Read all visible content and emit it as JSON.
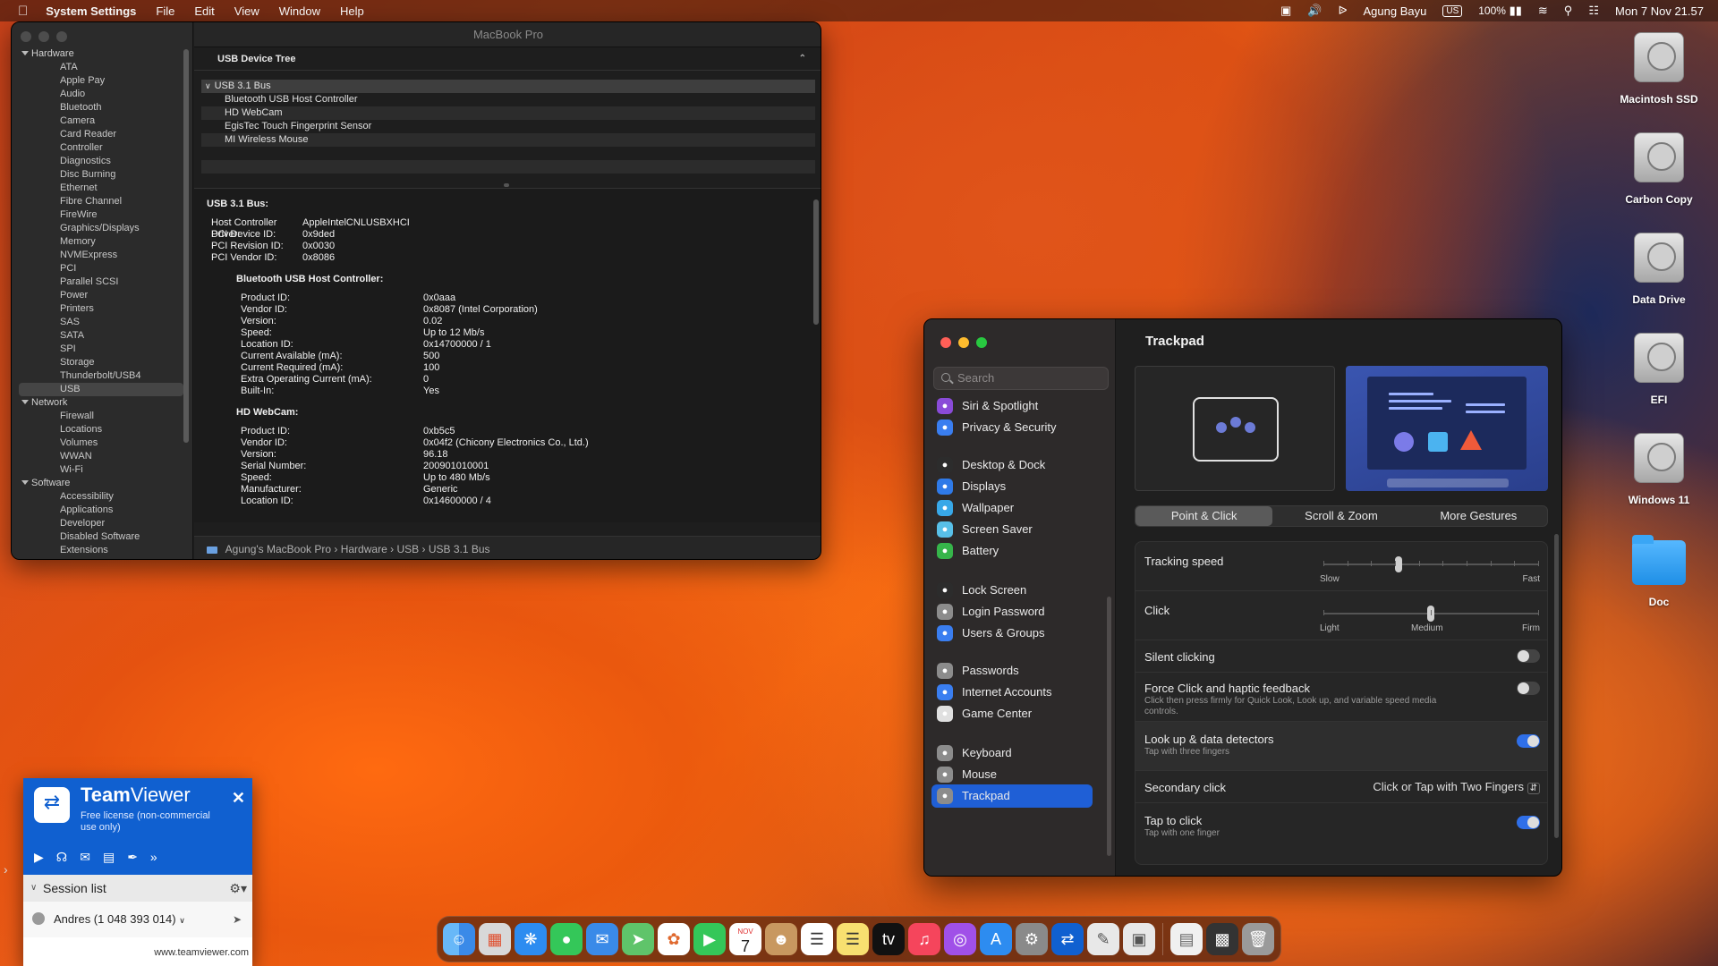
{
  "menubar": {
    "app": "System Settings",
    "menus": [
      "File",
      "Edit",
      "View",
      "Window",
      "Help"
    ],
    "user": "Agung Bayu",
    "input": "US",
    "battery": "100%",
    "datetime": "Mon 7 Nov  21.57"
  },
  "sysinfo": {
    "title": "MacBook Pro",
    "sidebar": {
      "hardware": "Hardware",
      "hardware_items": [
        "ATA",
        "Apple Pay",
        "Audio",
        "Bluetooth",
        "Camera",
        "Card Reader",
        "Controller",
        "Diagnostics",
        "Disc Burning",
        "Ethernet",
        "Fibre Channel",
        "FireWire",
        "Graphics/Displays",
        "Memory",
        "NVMExpress",
        "PCI",
        "Parallel SCSI",
        "Power",
        "Printers",
        "SAS",
        "SATA",
        "SPI",
        "Storage",
        "Thunderbolt/USB4",
        "USB"
      ],
      "network": "Network",
      "network_items": [
        "Firewall",
        "Locations",
        "Volumes",
        "WWAN",
        "Wi-Fi"
      ],
      "software": "Software",
      "software_items": [
        "Accessibility",
        "Applications",
        "Developer",
        "Disabled Software",
        "Extensions"
      ]
    },
    "tree_header": "USB Device Tree",
    "tree": {
      "bus": "USB 3.1 Bus",
      "devices": [
        "Bluetooth USB Host Controller",
        "HD WebCam",
        "EgisTec Touch Fingerprint Sensor",
        "MI Wireless Mouse"
      ]
    },
    "detail": {
      "bus_title": "USB 3.1 Bus:",
      "bus_props": [
        [
          "Host Controller Driver:",
          "AppleIntelCNLUSBXHCI"
        ],
        [
          "PCI Device ID:",
          "0x9ded"
        ],
        [
          "PCI Revision ID:",
          "0x0030"
        ],
        [
          "PCI Vendor ID:",
          "0x8086"
        ]
      ],
      "dev1_title": "Bluetooth USB Host Controller:",
      "dev1_props": [
        [
          "Product ID:",
          "0x0aaa"
        ],
        [
          "Vendor ID:",
          "0x8087  (Intel Corporation)"
        ],
        [
          "Version:",
          "0.02"
        ],
        [
          "Speed:",
          "Up to 12 Mb/s"
        ],
        [
          "Location ID:",
          "0x14700000 / 1"
        ],
        [
          "Current Available (mA):",
          "500"
        ],
        [
          "Current Required (mA):",
          "100"
        ],
        [
          "Extra Operating Current (mA):",
          "0"
        ],
        [
          "Built-In:",
          "Yes"
        ]
      ],
      "dev2_title": "HD WebCam:",
      "dev2_props": [
        [
          "Product ID:",
          "0xb5c5"
        ],
        [
          "Vendor ID:",
          "0x04f2  (Chicony Electronics Co., Ltd.)"
        ],
        [
          "Version:",
          "96.18"
        ],
        [
          "Serial Number:",
          "200901010001"
        ],
        [
          "Speed:",
          "Up to 480 Mb/s"
        ],
        [
          "Manufacturer:",
          "Generic"
        ],
        [
          "Location ID:",
          "0x14600000 / 4"
        ]
      ]
    },
    "path": [
      "Agung's MacBook Pro",
      "Hardware",
      "USB",
      "USB 3.1 Bus"
    ]
  },
  "settings": {
    "search_placeholder": "Search",
    "nav": [
      {
        "label": "Siri & Spotlight",
        "color": "#8a4bd8",
        "icon": "siri-icon"
      },
      {
        "label": "Privacy & Security",
        "color": "#3a7ef0",
        "icon": "hand-icon"
      },
      {
        "label": "Desktop & Dock",
        "color": "#2c2c2c",
        "icon": "dock-icon"
      },
      {
        "label": "Displays",
        "color": "#2f7ae8",
        "icon": "sun-icon"
      },
      {
        "label": "Wallpaper",
        "color": "#38a8e8",
        "icon": "flower-icon"
      },
      {
        "label": "Screen Saver",
        "color": "#58c0e8",
        "icon": "screensaver-icon"
      },
      {
        "label": "Battery",
        "color": "#36b54a",
        "icon": "battery-icon"
      },
      {
        "label": "Lock Screen",
        "color": "#2c2c2c",
        "icon": "lock-icon"
      },
      {
        "label": "Login Password",
        "color": "#8c8c8c",
        "icon": "key-icon"
      },
      {
        "label": "Users & Groups",
        "color": "#3a7ef0",
        "icon": "users-icon"
      },
      {
        "label": "Passwords",
        "color": "#8c8c8c",
        "icon": "password-key-icon"
      },
      {
        "label": "Internet Accounts",
        "color": "#3a7ef0",
        "icon": "at-icon"
      },
      {
        "label": "Game Center",
        "color": "#e0e0e0",
        "icon": "game-center-icon"
      },
      {
        "label": "Keyboard",
        "color": "#8c8c8c",
        "icon": "keyboard-icon"
      },
      {
        "label": "Mouse",
        "color": "#8c8c8c",
        "icon": "mouse-icon"
      },
      {
        "label": "Trackpad",
        "color": "#8c8c8c",
        "icon": "trackpad-icon"
      }
    ],
    "title": "Trackpad",
    "tabs": [
      "Point & Click",
      "Scroll & Zoom",
      "More Gestures"
    ],
    "tracking": {
      "label": "Tracking speed",
      "min": "Slow",
      "max": "Fast",
      "level": 0.35
    },
    "click": {
      "label": "Click",
      "l1": "Light",
      "l2": "Medium",
      "l3": "Firm",
      "level": 0.5
    },
    "silent": {
      "label": "Silent clicking",
      "on": false
    },
    "force": {
      "label": "Force Click and haptic feedback",
      "sub": "Click then press firmly for Quick Look, Look up, and variable speed media controls.",
      "on": false
    },
    "lookup": {
      "label": "Look up & data detectors",
      "sub": "Tap with three fingers",
      "on": true
    },
    "secondary": {
      "label": "Secondary click",
      "value": "Click or Tap with Two Fingers"
    },
    "tap": {
      "label": "Tap to click",
      "sub": "Tap with one finger",
      "on": true
    }
  },
  "desktop": [
    "Macintosh SSD",
    "Carbon Copy",
    "Data Drive",
    "EFI",
    "Windows 11",
    "Doc"
  ],
  "teamviewer": {
    "brand_a": "Team",
    "brand_b": "Viewer",
    "license": "Free license (non-commercial use only)",
    "session_list": "Session list",
    "user": "Andres (1 048 393 014)",
    "url": "www.teamviewer.com"
  },
  "dock": {
    "calendar_month": "NOV",
    "calendar_day": "7",
    "apps": [
      "finder-icon",
      "launchpad-icon",
      "safari-icon",
      "messages-icon",
      "mail-icon",
      "maps-icon",
      "photos-icon",
      "facetime-icon",
      "calendar-icon",
      "contacts-icon",
      "reminders-icon",
      "notes-icon",
      "appletv-icon",
      "music-icon",
      "podcasts-icon",
      "appstore-icon",
      "settings-icon",
      "teamviewer-icon",
      "script-editor-icon",
      "preview-icon",
      "documents-icon",
      "screenshot-icon",
      "trash-icon"
    ]
  }
}
